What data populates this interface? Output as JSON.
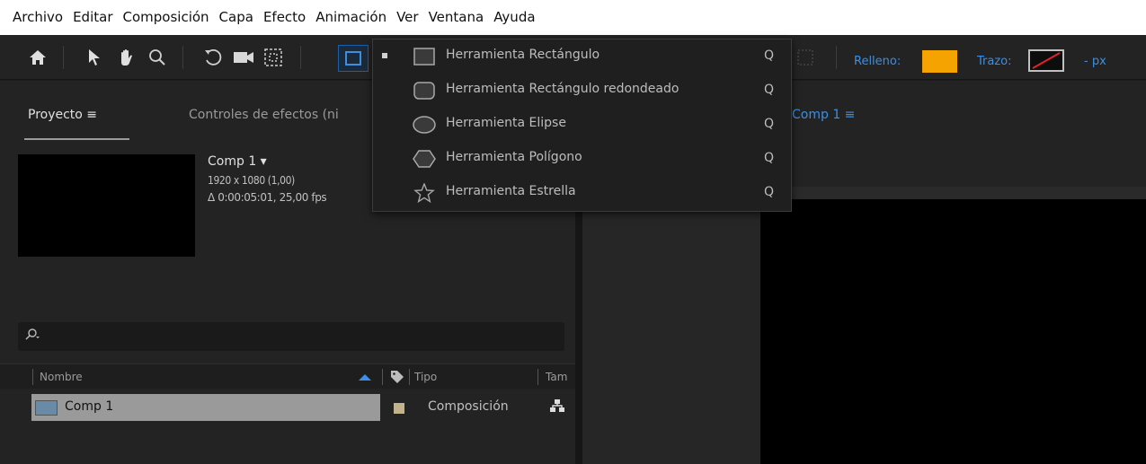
{
  "menu": [
    "Archivo",
    "Editar",
    "Composición",
    "Capa",
    "Efecto",
    "Animación",
    "Ver",
    "Ventana",
    "Ayuda"
  ],
  "toolbar": {
    "relleno_label": "Relleno:",
    "relleno_color": "#f5a300",
    "trazo_label": "Trazo:",
    "px_label": "- px"
  },
  "flyout": [
    {
      "label": "Herramienta Rectángulo",
      "shortcut": "Q",
      "icon": "rectangle-icon",
      "active": true
    },
    {
      "label": "Herramienta Rectángulo redondeado",
      "shortcut": "Q",
      "icon": "rounded-rectangle-icon",
      "active": false
    },
    {
      "label": "Herramienta Elipse",
      "shortcut": "Q",
      "icon": "ellipse-icon",
      "active": false
    },
    {
      "label": "Herramienta Polígono",
      "shortcut": "Q",
      "icon": "polygon-icon",
      "active": false
    },
    {
      "label": "Herramienta Estrella",
      "shortcut": "Q",
      "icon": "star-icon",
      "active": false
    }
  ],
  "project": {
    "tab_label": "Proyecto ≡",
    "effects_tab": "Controles de efectos (ni",
    "comp_name": "Comp 1 ▾",
    "comp_resolution": "1920 x 1080 (1,00)",
    "comp_duration": "Δ 0:00:05:01, 25,00 fps",
    "columns": [
      "Nombre",
      "Tipo",
      "Tam"
    ],
    "items": [
      {
        "name": "Comp 1",
        "type": "Composición"
      }
    ]
  },
  "composition_tab": "Comp 1 ≡"
}
